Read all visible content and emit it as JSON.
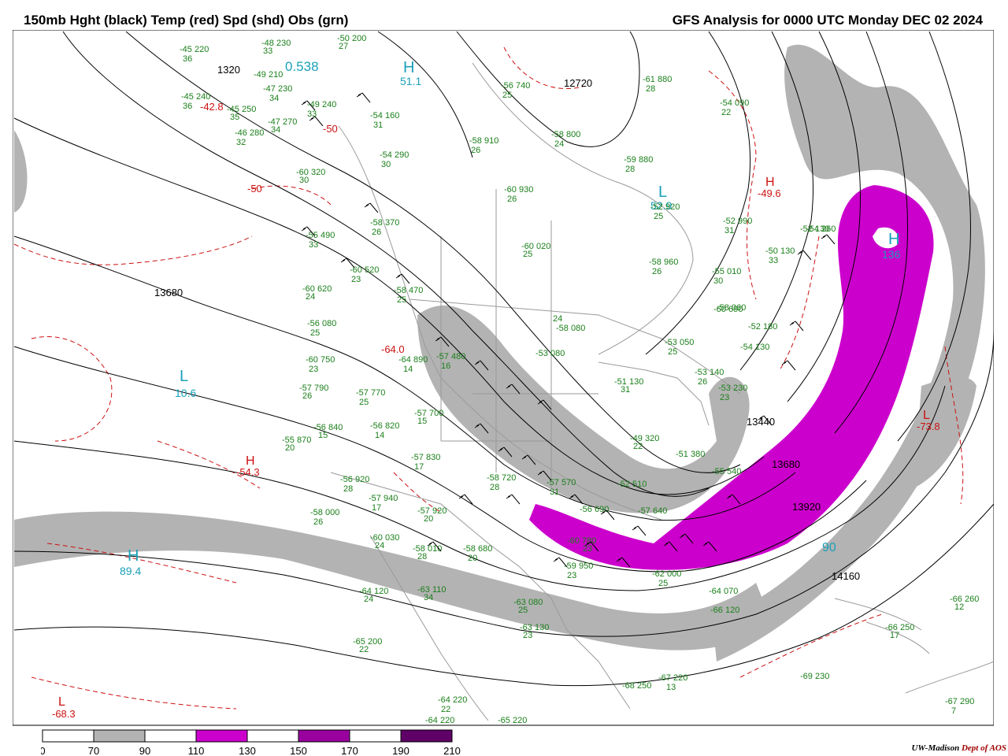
{
  "header": {
    "left_title": "150mb Hght (black) Temp (red) Spd (shd) Obs (grn)",
    "right_title": "GFS Analysis for 0000 UTC Monday  DEC 02 2024"
  },
  "map_labels": {
    "centers": [
      {
        "id": "h1",
        "text": "H",
        "value": "51.1",
        "color": "cyan"
      },
      {
        "id": "l1",
        "text": "L",
        "value": "10.6",
        "color": "cyan"
      },
      {
        "id": "h2",
        "text": "H",
        "value": "89.4",
        "color": "cyan"
      },
      {
        "id": "h3",
        "text": "H",
        "value": "136",
        "color": "cyan"
      },
      {
        "id": "l2",
        "text": "L",
        "value": "52.9",
        "color": "cyan"
      },
      {
        "id": "h4",
        "text": "H",
        "value": "-54.3",
        "color": "red"
      },
      {
        "id": "h5",
        "text": "H",
        "value": "-49.6",
        "color": "red"
      },
      {
        "id": "l3",
        "text": "L",
        "value": "-68.3",
        "color": "red"
      },
      {
        "id": "l4",
        "text": "L",
        "value": "-73.8",
        "color": "red"
      }
    ],
    "height_contours": [
      "1320",
      "12720",
      "13680",
      "13440",
      "13680",
      "13920",
      "14160"
    ],
    "misc": [
      "0.538",
      "-64.0",
      "90",
      "-50",
      "-50",
      "-42.8"
    ]
  },
  "observations": [
    "-45 220",
    "36",
    "-48 230",
    "33",
    "-50 200",
    "27",
    "-49 210",
    "-47 230",
    "34",
    "-45 240",
    "36",
    "-45 250",
    "35",
    "-47 270",
    "34",
    "-46 280",
    "32",
    "-49 240",
    "33",
    "-54 160",
    "31",
    "-54 290",
    "30",
    "-58 910",
    "26",
    "-56 740",
    "25",
    "-58 800",
    "24",
    "-60 930",
    "26",
    "-59 880",
    "28",
    "-61 880",
    "28",
    "-54 090",
    "22",
    "-52 920",
    "25",
    "-52 990",
    "31",
    "-52 130",
    "-50 130",
    "33",
    "-55 010",
    "30",
    "-58 960",
    "26",
    "-60 020",
    "25",
    "-60 320",
    "30",
    "-58 370",
    "26",
    "-55 490",
    "33",
    "-60 520",
    "23",
    "-58 470",
    "25",
    "-60 620",
    "24",
    "-60 690",
    "24",
    "-58 080",
    "-56 080",
    "25",
    "-60 750",
    "23",
    "-64 890",
    "14",
    "-57 480",
    "16",
    "-57 770",
    "25",
    "-57 790",
    "26",
    "-56 840",
    "15",
    "-56 820",
    "14",
    "-55 870",
    "20",
    "-57 700",
    "15",
    "-57 830",
    "17",
    "-56 920",
    "28",
    "-57 940",
    "17",
    "-58 000",
    "26",
    "-60 030",
    "24",
    "-57 920",
    "20",
    "-58 010",
    "28",
    "-58 680",
    "20",
    "-53 050",
    "25",
    "-53 140",
    "26",
    "-53 230",
    "23",
    "-54 130",
    "-51 130",
    "31",
    "-49 320",
    "22",
    "-51 380",
    "-52 510",
    "-55 540",
    "-58 720",
    "28",
    "-57 570",
    "31",
    "-57 640",
    "-56 690",
    "-60 780",
    "23",
    "-59 950",
    "23",
    "-62 000",
    "25",
    "-64 070",
    "-66 120",
    "-66 260",
    "12",
    "-66 250",
    "17",
    "-64 120",
    "24",
    "-63 110",
    "34",
    "-63 080",
    "25",
    "-63 130",
    "23",
    "-65 200",
    "22",
    "-64 220",
    "22",
    "-64 220",
    "-65 220",
    "-67 220",
    "-68 250",
    "13",
    "-69 230",
    "-67 290",
    "7",
    "-54 260",
    "-58 060",
    "-53 080",
    "-52 180"
  ],
  "legend": {
    "ticks": [
      "0",
      "70",
      "90",
      "110",
      "130",
      "150",
      "170",
      "190",
      "210"
    ],
    "colors": [
      "#ffffff",
      "#b3b3b3",
      "#ffffff",
      "#cc00cc",
      "#ffffff",
      "#99009e",
      "#ffffff",
      "#5e0066"
    ]
  },
  "credit": {
    "org": "UW-Madison",
    "dept": "Dept of AOS"
  }
}
